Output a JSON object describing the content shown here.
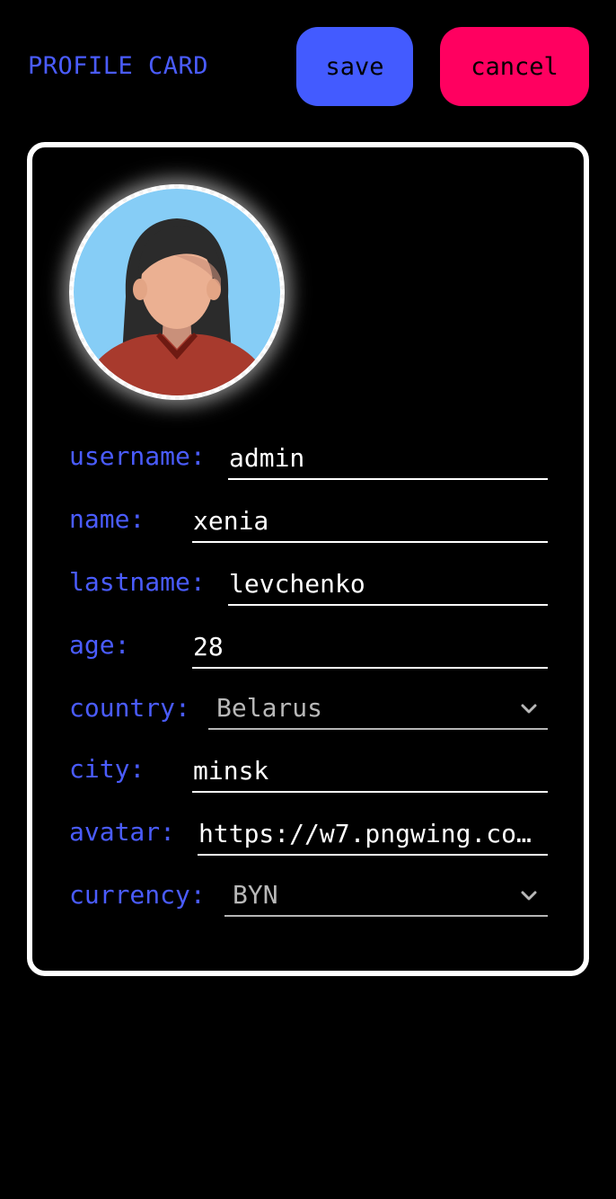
{
  "header": {
    "title": "PROFILE CARD",
    "save_label": "save",
    "cancel_label": "cancel"
  },
  "colors": {
    "accent_label": "#4a5cff",
    "save_button": "#435bff",
    "cancel_button": "#ff0060",
    "background": "#000000",
    "card_border": "#ffffff"
  },
  "avatar": {
    "icon": "woman-avatar-icon"
  },
  "fields": {
    "username": {
      "label": "username:",
      "value": "admin"
    },
    "name": {
      "label": "name:",
      "value": "xenia"
    },
    "lastname": {
      "label": "lastname:",
      "value": "levchenko"
    },
    "age": {
      "label": "age:",
      "value": "28"
    },
    "country": {
      "label": "country:",
      "value": "Belarus"
    },
    "city": {
      "label": "city:",
      "value": "minsk"
    },
    "avatar_url": {
      "label": "avatar:",
      "value": "https://w7.pngwing.co…"
    },
    "currency": {
      "label": "currency:",
      "value": "BYN"
    }
  }
}
